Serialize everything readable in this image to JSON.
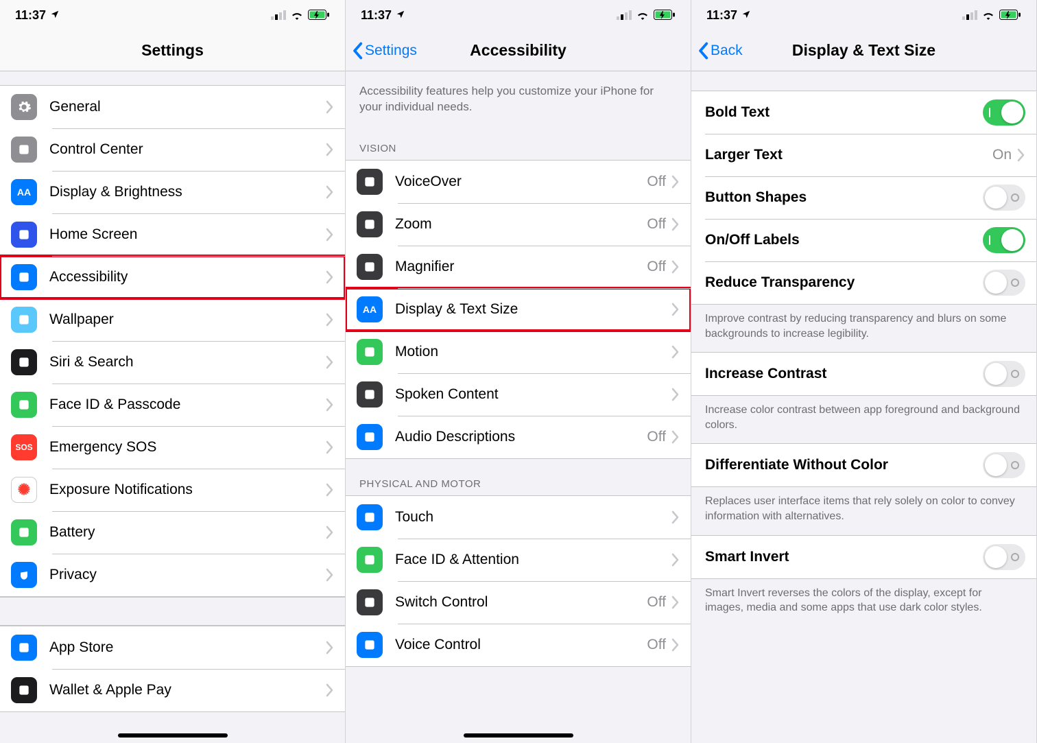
{
  "status": {
    "time": "11:37"
  },
  "screen1": {
    "title": "Settings",
    "items": [
      {
        "label": "General",
        "icon": "gear",
        "iconClass": "ic-gray"
      },
      {
        "label": "Control Center",
        "icon": "sliders",
        "iconClass": "ic-gray"
      },
      {
        "label": "Display & Brightness",
        "icon": "AA",
        "iconClass": "ic-blue"
      },
      {
        "label": "Home Screen",
        "icon": "grid",
        "iconClass": "ic-home"
      },
      {
        "label": "Accessibility",
        "icon": "access",
        "iconClass": "ic-blue",
        "highlight": true
      },
      {
        "label": "Wallpaper",
        "icon": "flower",
        "iconClass": "ic-lblue"
      },
      {
        "label": "Siri & Search",
        "icon": "siri",
        "iconClass": "ic-black"
      },
      {
        "label": "Face ID & Passcode",
        "icon": "faceid",
        "iconClass": "ic-green"
      },
      {
        "label": "Emergency SOS",
        "icon": "SOS",
        "iconClass": "ic-red"
      },
      {
        "label": "Exposure Notifications",
        "icon": "covid",
        "iconClass": "ic-cov"
      },
      {
        "label": "Battery",
        "icon": "battery",
        "iconClass": "ic-green"
      },
      {
        "label": "Privacy",
        "icon": "hand",
        "iconClass": "ic-blue"
      }
    ],
    "items2": [
      {
        "label": "App Store",
        "icon": "appstore",
        "iconClass": "ic-blue"
      },
      {
        "label": "Wallet & Apple Pay",
        "icon": "wallet",
        "iconClass": "ic-black"
      }
    ]
  },
  "screen2": {
    "back": "Settings",
    "title": "Accessibility",
    "intro": "Accessibility features help you customize your iPhone for your individual needs.",
    "visionHeader": "Vision",
    "visionItems": [
      {
        "label": "VoiceOver",
        "value": "Off",
        "iconClass": "ic-dark"
      },
      {
        "label": "Zoom",
        "value": "Off",
        "iconClass": "ic-dark"
      },
      {
        "label": "Magnifier",
        "value": "Off",
        "iconClass": "ic-dark"
      },
      {
        "label": "Display & Text Size",
        "value": "",
        "iconClass": "ic-blue",
        "aa": true,
        "highlight": true
      },
      {
        "label": "Motion",
        "value": "",
        "iconClass": "ic-green"
      },
      {
        "label": "Spoken Content",
        "value": "",
        "iconClass": "ic-dark"
      },
      {
        "label": "Audio Descriptions",
        "value": "Off",
        "iconClass": "ic-blue"
      }
    ],
    "motorHeader": "Physical and Motor",
    "motorItems": [
      {
        "label": "Touch",
        "value": "",
        "iconClass": "ic-blue"
      },
      {
        "label": "Face ID & Attention",
        "value": "",
        "iconClass": "ic-green"
      },
      {
        "label": "Switch Control",
        "value": "Off",
        "iconClass": "ic-dark"
      },
      {
        "label": "Voice Control",
        "value": "Off",
        "iconClass": "ic-blue"
      }
    ]
  },
  "screen3": {
    "back": "Back",
    "title": "Display & Text Size",
    "rows": [
      {
        "label": "Bold Text",
        "type": "toggle",
        "on": true
      },
      {
        "label": "Larger Text",
        "type": "link",
        "value": "On"
      },
      {
        "label": "Button Shapes",
        "type": "toggle",
        "on": false
      },
      {
        "label": "On/Off Labels",
        "type": "toggle",
        "on": true
      },
      {
        "label": "Reduce Transparency",
        "type": "toggle",
        "on": false
      }
    ],
    "footer1": "Improve contrast by reducing transparency and blurs on some backgrounds to increase legibility.",
    "rows2": [
      {
        "label": "Increase Contrast",
        "type": "toggle",
        "on": false
      }
    ],
    "footer2": "Increase color contrast between app foreground and background colors.",
    "rows3": [
      {
        "label": "Differentiate Without Color",
        "type": "toggle",
        "on": false
      }
    ],
    "footer3": "Replaces user interface items that rely solely on color to convey information with alternatives.",
    "rows4": [
      {
        "label": "Smart Invert",
        "type": "toggle",
        "on": false
      }
    ],
    "footer4": "Smart Invert reverses the colors of the display, except for images, media and some apps that use dark color styles."
  }
}
